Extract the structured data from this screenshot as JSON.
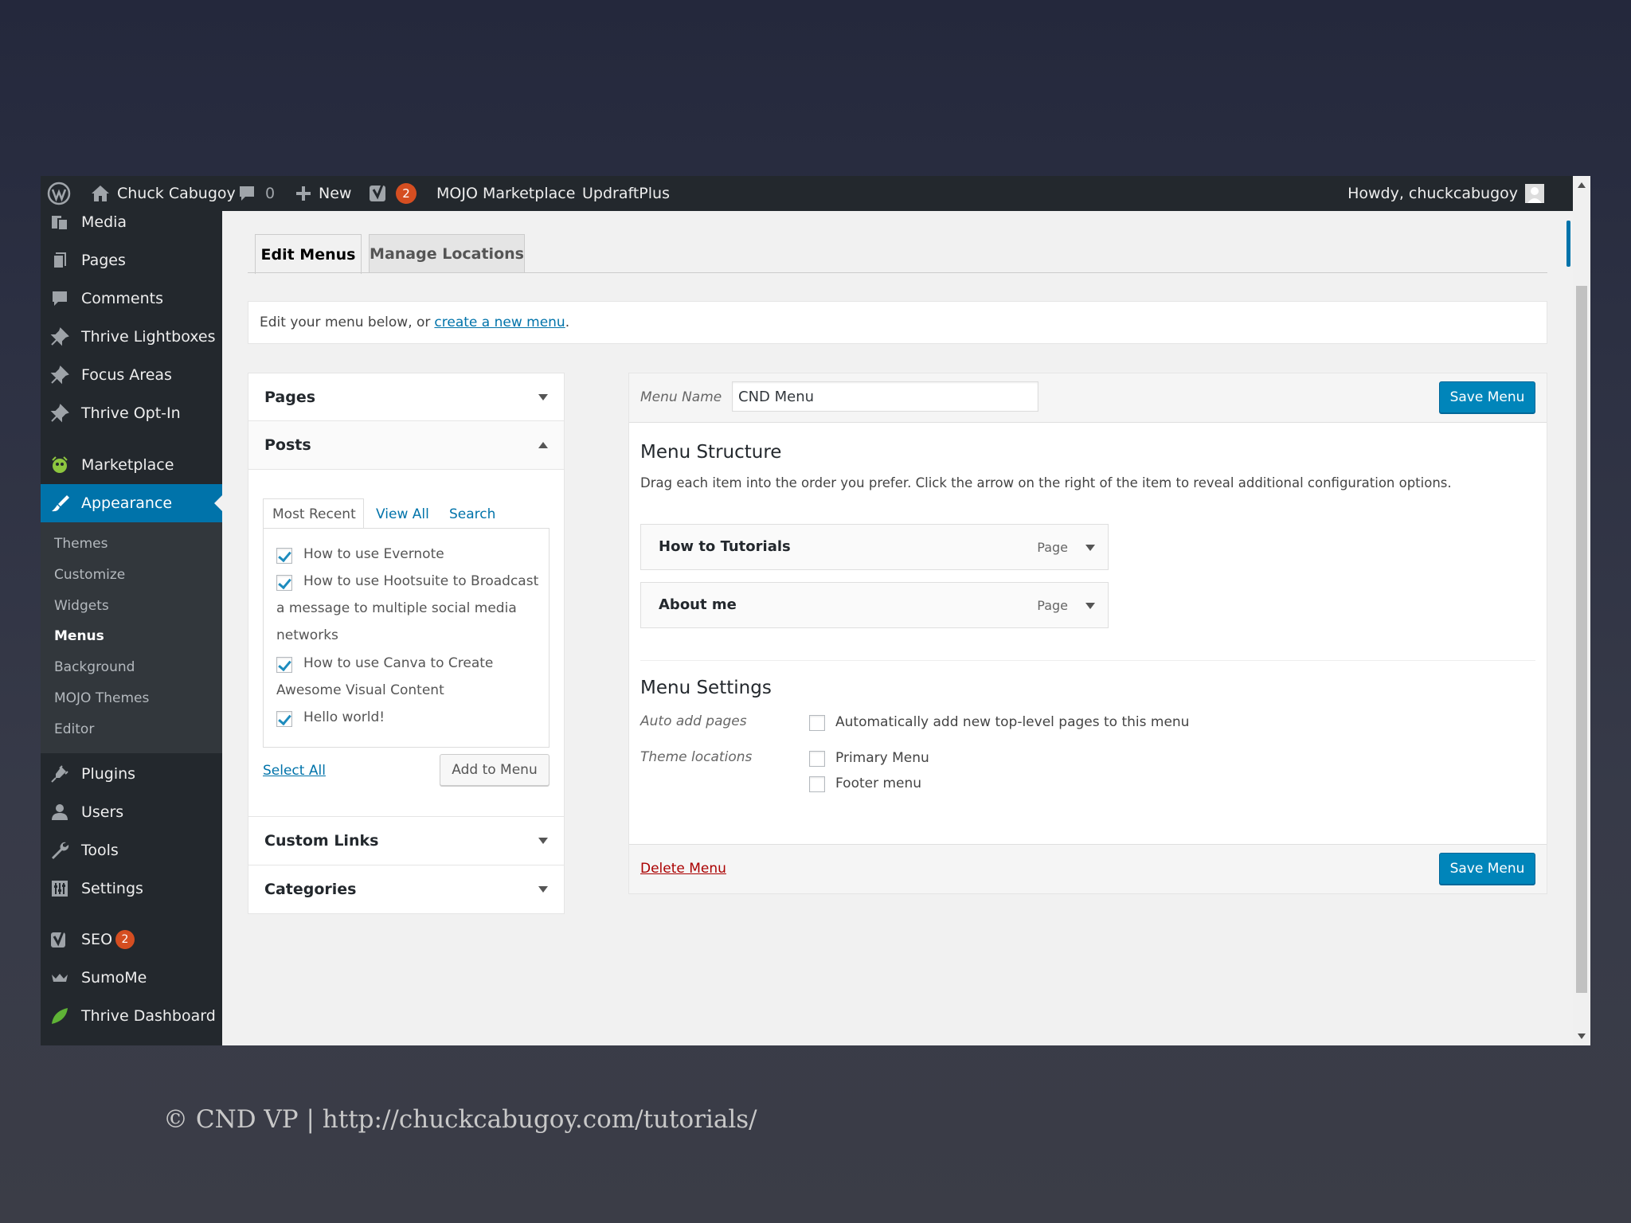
{
  "admin_bar": {
    "site_name": "Chuck Cabugoy",
    "comments_count": "0",
    "new_label": "New",
    "seo_count": "2",
    "mojo_label": "MOJO Marketplace",
    "updraft_label": "UpdraftPlus",
    "howdy": "Howdy, chuckcabugoy"
  },
  "sidebar": {
    "items": [
      {
        "label": "Media",
        "icon": "media-icon"
      },
      {
        "label": "Pages",
        "icon": "pages-icon"
      },
      {
        "label": "Comments",
        "icon": "comments-icon"
      },
      {
        "label": "Thrive Lightboxes",
        "icon": "pin-icon"
      },
      {
        "label": "Focus Areas",
        "icon": "pin-icon"
      },
      {
        "label": "Thrive Opt-In",
        "icon": "pin-icon"
      },
      {
        "label": "Marketplace",
        "icon": "marketplace-icon"
      },
      {
        "label": "Appearance",
        "icon": "brush-icon"
      },
      {
        "label": "Plugins",
        "icon": "plugin-icon"
      },
      {
        "label": "Users",
        "icon": "users-icon"
      },
      {
        "label": "Tools",
        "icon": "wrench-icon"
      },
      {
        "label": "Settings",
        "icon": "settings-icon"
      },
      {
        "label": "SEO",
        "icon": "yoast-icon",
        "badge": "2"
      },
      {
        "label": "SumoMe",
        "icon": "crown-icon"
      },
      {
        "label": "Thrive Dashboard",
        "icon": "leaf-icon"
      }
    ],
    "submenu": [
      "Themes",
      "Customize",
      "Widgets",
      "Menus",
      "Background",
      "MOJO Themes",
      "Editor"
    ]
  },
  "tabs": {
    "edit": "Edit Menus",
    "manage": "Manage Locations"
  },
  "notice": {
    "text": "Edit your menu below, or ",
    "link": "create a new menu",
    "end": "."
  },
  "left": {
    "pages_title": "Pages",
    "posts_title": "Posts",
    "subtabs": [
      "Most Recent",
      "View All",
      "Search"
    ],
    "posts": [
      {
        "label": "How to use Evernote"
      },
      {
        "label": "How to use Hootsuite to Broadcast",
        "cont": [
          "a message to multiple social media",
          "networks"
        ]
      },
      {
        "label": "How to use Canva to Create",
        "cont": [
          "Awesome Visual Content"
        ]
      },
      {
        "label": "Hello world!"
      }
    ],
    "select_all": "Select All",
    "add_to_menu": "Add to Menu",
    "custom_links": "Custom Links",
    "categories": "Categories"
  },
  "menu": {
    "name_label": "Menu Name",
    "name_value": "CND Menu",
    "save": "Save Menu",
    "structure_title": "Menu Structure",
    "structure_desc": "Drag each item into the order you prefer. Click the arrow on the right of the item to reveal additional configuration options.",
    "items": [
      {
        "title": "How to Tutorials",
        "type": "Page"
      },
      {
        "title": "About me",
        "type": "Page"
      }
    ],
    "settings_title": "Menu Settings",
    "auto_add_label": "Auto add pages",
    "auto_add_option": "Automatically add new top-level pages to this menu",
    "theme_locations_label": "Theme locations",
    "locations": [
      "Primary Menu",
      "Footer menu"
    ],
    "delete": "Delete Menu"
  },
  "footer_credit": "© CND VP | http://chuckcabugoy.com/tutorials/",
  "colors": {
    "accent": "#0073aa",
    "primary_button": "#0085ba",
    "admin_bar": "#23282d",
    "badge": "#d54e21",
    "delete": "#a00"
  }
}
